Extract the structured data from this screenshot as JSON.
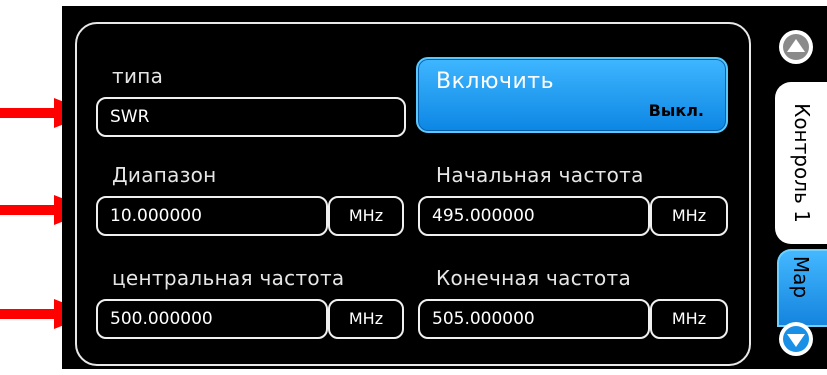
{
  "fields": {
    "type": {
      "label": "типа",
      "value": "SWR"
    },
    "span": {
      "label": "Диапазон",
      "value": "10.000000",
      "unit": "MHz"
    },
    "start": {
      "label": "Начальная частота",
      "value": "495.000000",
      "unit": "MHz"
    },
    "center": {
      "label": "центральная частота",
      "value": "500.000000",
      "unit": "MHz"
    },
    "stop": {
      "label": "Конечная частота",
      "value": "505.000000",
      "unit": "MHz"
    }
  },
  "toggle": {
    "label": "Включить",
    "state": "Выкл."
  },
  "side_tabs": {
    "control": "Контроль 1",
    "marker": "Мар"
  },
  "icons": {
    "scroll_up": "up-arrow-circle-icon",
    "scroll_down": "down-arrow-circle-icon",
    "annotation_arrow": "red-arrow-icon"
  },
  "colors": {
    "screen_bg": "#000000",
    "accent_blue": "#1a9cf0",
    "annotation_red": "#ff0000"
  }
}
